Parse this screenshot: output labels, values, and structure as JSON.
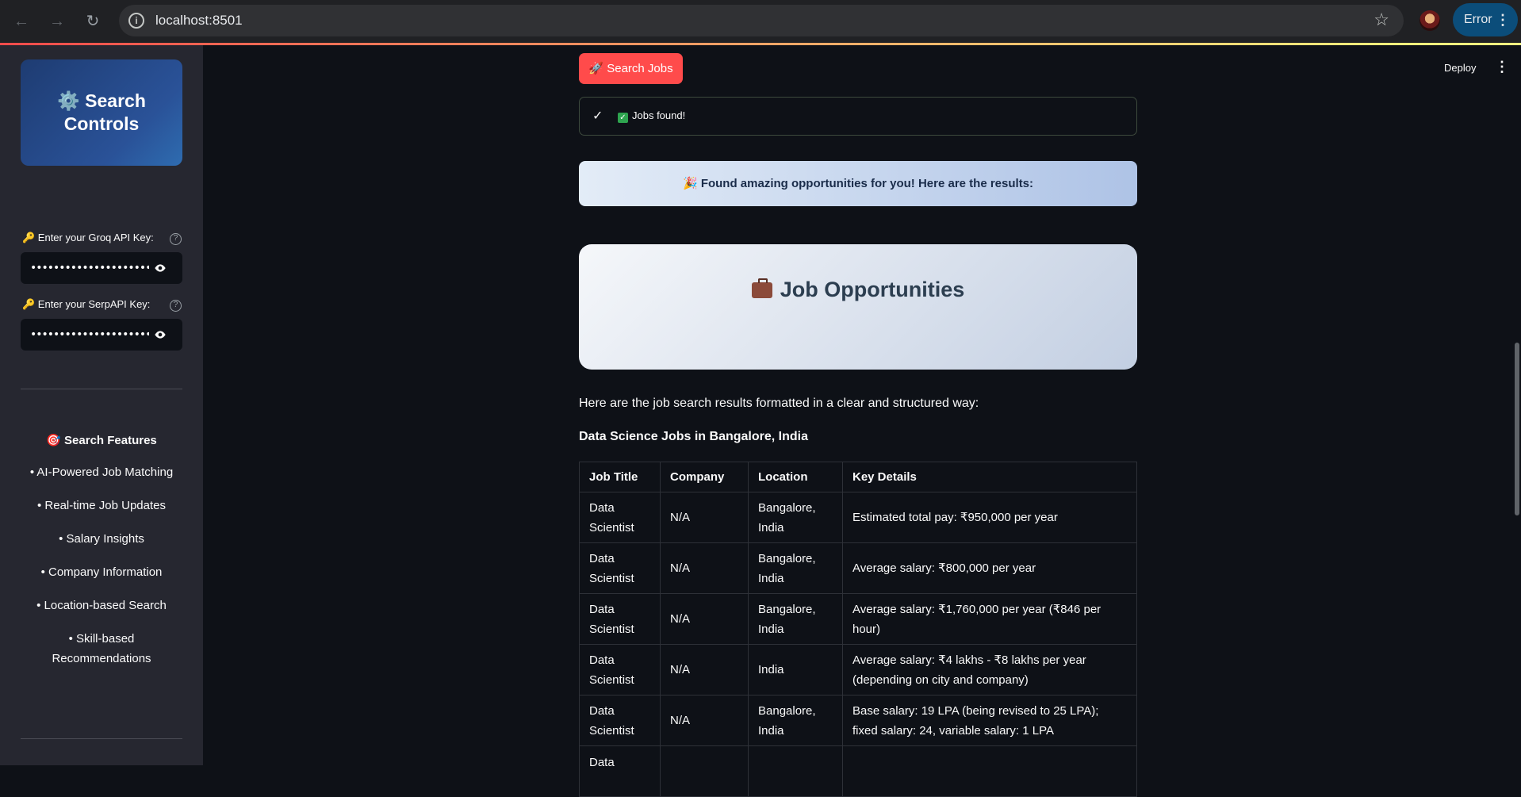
{
  "browser": {
    "url": "localhost:8501",
    "error_label": "Error"
  },
  "sidebar": {
    "header": "⚙️ Search Controls",
    "groq_label": "🔑 Enter your Groq API Key:",
    "groq_value": "••••••••••••••••••••••••••••••",
    "serp_label": "🔑 Enter your SerpAPI Key:",
    "serp_value": "••••••••••••••••••••••••••••••",
    "features_title": "🎯 Search Features",
    "features": [
      "• AI-Powered Job Matching",
      "• Real-time Job Updates",
      "• Salary Insights",
      "• Company Information",
      "• Location-based Search",
      "• Skill-based Recommendations"
    ]
  },
  "toolbar": {
    "deploy_label": "Deploy"
  },
  "main": {
    "search_button": "🚀 Search Jobs",
    "status_message": "Jobs found!",
    "banner": "🎉 Found amazing opportunities for you! Here are the results:",
    "card_title": "Job Opportunities",
    "intro": "Here are the job search results formatted in a clear and structured way:",
    "subheading": "Data Science Jobs in Bangalore, India",
    "table": {
      "headers": [
        "Job Title",
        "Company",
        "Location",
        "Key Details"
      ],
      "rows": [
        [
          "Data Scientist",
          "N/A",
          "Bangalore, India",
          "Estimated total pay: ₹950,000 per year"
        ],
        [
          "Data Scientist",
          "N/A",
          "Bangalore, India",
          "Average salary: ₹800,000 per year"
        ],
        [
          "Data Scientist",
          "N/A",
          "Bangalore, India",
          "Average salary: ₹1,760,000 per year (₹846 per hour)"
        ],
        [
          "Data Scientist",
          "N/A",
          "India",
          "Average salary: ₹4 lakhs - ₹8 lakhs per year (depending on city and company)"
        ],
        [
          "Data Scientist",
          "N/A",
          "Bangalore, India",
          "Base salary: 19 LPA (being revised to 25 LPA); fixed salary: 24, variable salary: 1 LPA"
        ],
        [
          "Data",
          "",
          "",
          ""
        ]
      ]
    }
  }
}
